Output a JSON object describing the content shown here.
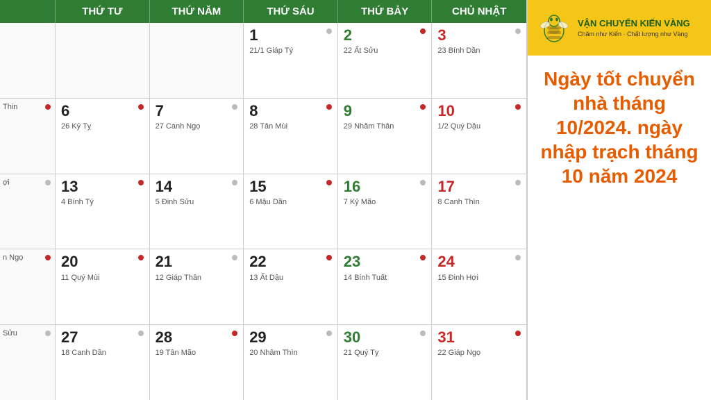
{
  "header": {
    "days": [
      "",
      "THỨ TƯ",
      "THỨ NĂM",
      "THỨ SÁU",
      "THỨ BẢY",
      "CHỦ NHẬT"
    ]
  },
  "rows": [
    {
      "left": "",
      "cells": [
        {
          "day": "",
          "lunar": "",
          "dot": "",
          "type": "empty"
        },
        {
          "day": "",
          "lunar": "",
          "dot": "",
          "type": "empty"
        },
        {
          "day": "1",
          "lunar": "21/1 Giáp Tý",
          "dot": "gray",
          "type": "normal"
        },
        {
          "day": "2",
          "lunar": "22 Ất Sửu",
          "dot": "red",
          "type": "saturday"
        },
        {
          "day": "3",
          "lunar": "23 Bính Dần",
          "dot": "gray",
          "type": "sunday"
        }
      ]
    },
    {
      "left": "Thin",
      "leftDot": "red",
      "cells": [
        {
          "day": "6",
          "lunar": "26 Kỷ Tỵ",
          "dot": "red",
          "type": "normal"
        },
        {
          "day": "7",
          "lunar": "27 Canh Ngọ",
          "dot": "gray",
          "type": "normal"
        },
        {
          "day": "8",
          "lunar": "28 Tân Mùi",
          "dot": "red",
          "type": "normal"
        },
        {
          "day": "9",
          "lunar": "29 Nhâm Thân",
          "dot": "red",
          "type": "saturday"
        },
        {
          "day": "10",
          "lunar": "1/2 Quý Dậu",
          "dot": "red",
          "type": "sunday"
        }
      ]
    },
    {
      "left": "ợi",
      "leftDot": "gray",
      "cells": [
        {
          "day": "13",
          "lunar": "4 Bính Tý",
          "dot": "red",
          "type": "normal"
        },
        {
          "day": "14",
          "lunar": "5 Đinh Sửu",
          "dot": "gray",
          "type": "normal"
        },
        {
          "day": "15",
          "lunar": "6 Mậu Dần",
          "dot": "red",
          "type": "normal"
        },
        {
          "day": "16",
          "lunar": "7 Kỷ Mão",
          "dot": "gray",
          "type": "saturday"
        },
        {
          "day": "17",
          "lunar": "8 Canh Thìn",
          "dot": "gray",
          "type": "sunday"
        }
      ]
    },
    {
      "left": "n Ngọ",
      "leftDot": "red",
      "cells": [
        {
          "day": "20",
          "lunar": "11 Quý Mùi",
          "dot": "red",
          "type": "normal"
        },
        {
          "day": "21",
          "lunar": "12 Giáp Thân",
          "dot": "gray",
          "type": "normal"
        },
        {
          "day": "22",
          "lunar": "13 Ất Dậu",
          "dot": "red",
          "type": "normal"
        },
        {
          "day": "23",
          "lunar": "14 Bính Tuất",
          "dot": "red",
          "type": "saturday"
        },
        {
          "day": "24",
          "lunar": "15 Đinh Hợi",
          "dot": "gray",
          "type": "sunday"
        }
      ]
    },
    {
      "left": "Sửu",
      "leftDot": "gray",
      "cells": [
        {
          "day": "27",
          "lunar": "18 Canh Dần",
          "dot": "gray",
          "type": "normal"
        },
        {
          "day": "28",
          "lunar": "19 Tân Mão",
          "dot": "red",
          "type": "normal"
        },
        {
          "day": "29",
          "lunar": "20 Nhâm Thìn",
          "dot": "gray",
          "type": "normal"
        },
        {
          "day": "30",
          "lunar": "21 Quý Tỵ",
          "dot": "gray",
          "type": "saturday"
        },
        {
          "day": "31",
          "lunar": "22 Giáp Ngọ",
          "dot": "red",
          "type": "sunday"
        }
      ]
    }
  ],
  "promo": {
    "text": "Ngày tốt chuyển nhà tháng 10/2024. ngày nhập trạch tháng 10 năm 2024"
  },
  "logo": {
    "title": "VẬN CHUYỂN KIẾN VÀNG",
    "subtitle": "Chăm như Kiến · Chất lượng như Vàng"
  }
}
